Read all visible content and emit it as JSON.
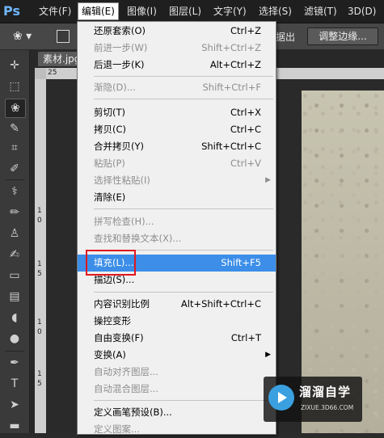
{
  "app": {
    "logo_text": "Ps"
  },
  "menubar": {
    "items": [
      "文件(F)",
      "编辑(E)",
      "图像(I)",
      "图层(L)",
      "文字(Y)",
      "选择(S)",
      "滤镜(T)",
      "3D(D)"
    ],
    "active": "编辑(E)"
  },
  "options_bar": {
    "partial_text": "据出",
    "refine_edge_label": "调整边缘..."
  },
  "document": {
    "tab_label": "素材.jpg",
    "ruler_top": [
      "25"
    ],
    "ruler_left": [
      "1",
      "0",
      "1",
      "5",
      "1",
      "0",
      "1",
      "5"
    ]
  },
  "edit_menu": {
    "items": [
      {
        "label": "还原套索(O)",
        "shortcut": "Ctrl+Z",
        "state": "enabled"
      },
      {
        "label": "前进一步(W)",
        "shortcut": "Shift+Ctrl+Z",
        "state": "disabled"
      },
      {
        "label": "后退一步(K)",
        "shortcut": "Alt+Ctrl+Z",
        "state": "enabled"
      },
      {
        "label": "渐隐(D)...",
        "shortcut": "Shift+Ctrl+F",
        "state": "disabled"
      },
      {
        "label": "剪切(T)",
        "shortcut": "Ctrl+X",
        "state": "enabled"
      },
      {
        "label": "拷贝(C)",
        "shortcut": "Ctrl+C",
        "state": "enabled"
      },
      {
        "label": "合并拷贝(Y)",
        "shortcut": "Shift+Ctrl+C",
        "state": "enabled"
      },
      {
        "label": "粘贴(P)",
        "shortcut": "Ctrl+V",
        "state": "disabled"
      },
      {
        "label": "选择性粘贴(I)",
        "shortcut": "",
        "state": "disabled",
        "submenu": true
      },
      {
        "label": "清除(E)",
        "shortcut": "",
        "state": "enabled"
      },
      {
        "label": "拼写检查(H)...",
        "shortcut": "",
        "state": "disabled"
      },
      {
        "label": "查找和替换文本(X)...",
        "shortcut": "",
        "state": "disabled"
      },
      {
        "label": "填充(L)...",
        "shortcut": "Shift+F5",
        "state": "highlighted"
      },
      {
        "label": "描边(S)...",
        "shortcut": "",
        "state": "enabled"
      },
      {
        "label": "内容识别比例",
        "shortcut": "Alt+Shift+Ctrl+C",
        "state": "enabled"
      },
      {
        "label": "操控变形",
        "shortcut": "",
        "state": "enabled"
      },
      {
        "label": "自由变换(F)",
        "shortcut": "Ctrl+T",
        "state": "enabled"
      },
      {
        "label": "变换(A)",
        "shortcut": "",
        "state": "enabled",
        "submenu": true
      },
      {
        "label": "自动对齐图层...",
        "shortcut": "",
        "state": "disabled"
      },
      {
        "label": "自动混合图层...",
        "shortcut": "",
        "state": "disabled"
      },
      {
        "label": "定义画笔预设(B)...",
        "shortcut": "",
        "state": "enabled"
      },
      {
        "label": "定义图案...",
        "shortcut": "",
        "state": "disabled"
      }
    ]
  },
  "watermark": {
    "brand": "溜溜自学",
    "url": "ZIXUE.3D66.COM"
  },
  "colors": {
    "highlight": "#3c8ee8",
    "annotation_box": "#e0181f",
    "menubar_bg": "#1f1f1f"
  }
}
